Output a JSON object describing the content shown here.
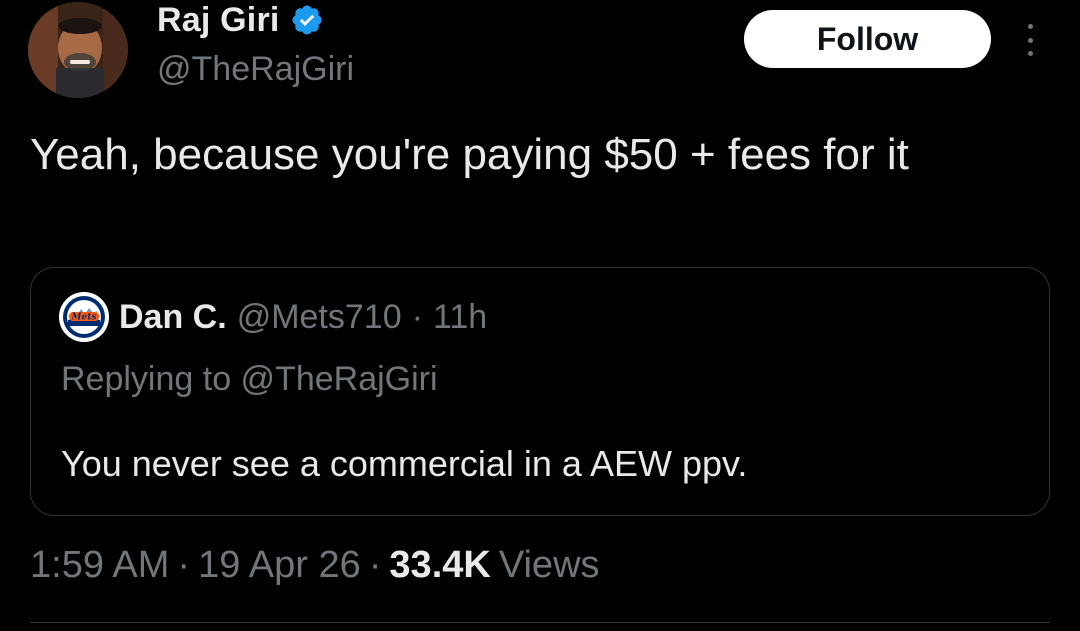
{
  "author": {
    "name": "Raj Giri",
    "handle": "@TheRajGiri",
    "verified": true
  },
  "actions": {
    "follow_label": "Follow"
  },
  "tweet": {
    "text": "Yeah, because you're paying $50 + fees for it"
  },
  "quoted_tweet": {
    "name": "Dan C.",
    "handle": "@Mets710",
    "separator": "·",
    "time": "11h",
    "replying_to": "Replying to @TheRajGiri",
    "text": "You never see a commercial in a AEW ppv."
  },
  "meta": {
    "time": "1:59 AM",
    "separator": "·",
    "date": "19 Apr 26",
    "views_count": "33.4K",
    "views_label": "Views"
  },
  "colors": {
    "background": "#000000",
    "text_primary": "#e7e9ea",
    "text_secondary": "#71767b",
    "verified_blue": "#1d9bf0",
    "border": "#2f3336",
    "follow_bg": "#ffffff"
  },
  "icons": {
    "verified": "verified-badge-icon",
    "more": "more-dots-icon"
  }
}
